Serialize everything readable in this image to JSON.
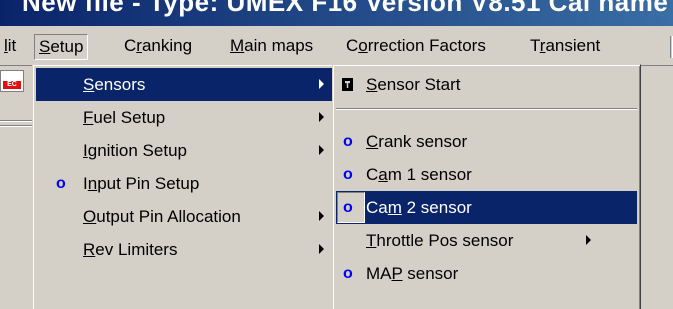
{
  "window": {
    "title": "New file - Type: UMEX F16 Version V8.51 Cal name"
  },
  "menubar": {
    "items": [
      {
        "pre": "",
        "key": "l",
        "post": "it"
      },
      {
        "pre": "",
        "key": "S",
        "post": "etup"
      },
      {
        "pre": "C",
        "key": "r",
        "post": "anking"
      },
      {
        "pre": "",
        "key": "M",
        "post": "ain maps"
      },
      {
        "pre": "C",
        "key": "o",
        "post": "rrection Factors"
      },
      {
        "pre": "T",
        "key": "r",
        "post": "ansient"
      }
    ]
  },
  "setup_menu": {
    "items": [
      {
        "pre": "",
        "key": "S",
        "post": "ensors",
        "submenu": true,
        "highlighted": true,
        "bullet": ""
      },
      {
        "pre": "",
        "key": "F",
        "post": "uel Setup",
        "submenu": true,
        "highlighted": false,
        "bullet": ""
      },
      {
        "pre": "",
        "key": "I",
        "post": "gnition Setup",
        "submenu": true,
        "highlighted": false,
        "bullet": ""
      },
      {
        "pre": "I",
        "key": "n",
        "post": "put Pin Setup",
        "submenu": false,
        "highlighted": false,
        "bullet": "o"
      },
      {
        "pre": "",
        "key": "O",
        "post": "utput Pin Allocation",
        "submenu": true,
        "highlighted": false,
        "bullet": ""
      },
      {
        "pre": "",
        "key": "R",
        "post": "ev Limiters",
        "submenu": true,
        "highlighted": false,
        "bullet": ""
      }
    ]
  },
  "sensors_menu": {
    "items": [
      {
        "pre": "",
        "key": "S",
        "post": "ensor Start",
        "icon": "checkbox",
        "submenu": false,
        "highlighted": false
      },
      {
        "pre": "",
        "key": "C",
        "post": "rank sensor",
        "icon": "bullet",
        "submenu": false,
        "highlighted": false
      },
      {
        "pre": "C",
        "key": "a",
        "post": "m 1 sensor",
        "icon": "bullet",
        "submenu": false,
        "highlighted": false
      },
      {
        "pre": "Ca",
        "key": "m",
        "post": " 2 sensor",
        "icon": "bullet",
        "submenu": false,
        "highlighted": true
      },
      {
        "pre": "",
        "key": "T",
        "post": "hrottle Pos sensor",
        "icon": "",
        "submenu": true,
        "highlighted": false
      },
      {
        "pre": "MA",
        "key": "P",
        "post": " sensor",
        "icon": "bullet",
        "submenu": false,
        "highlighted": false
      }
    ],
    "bullet_glyph": "o"
  },
  "colors": {
    "highlight": "#0a246a",
    "bullet": "#0000ff",
    "face": "#d4d0c8"
  },
  "toolbar": {
    "icon_label": "EC"
  }
}
